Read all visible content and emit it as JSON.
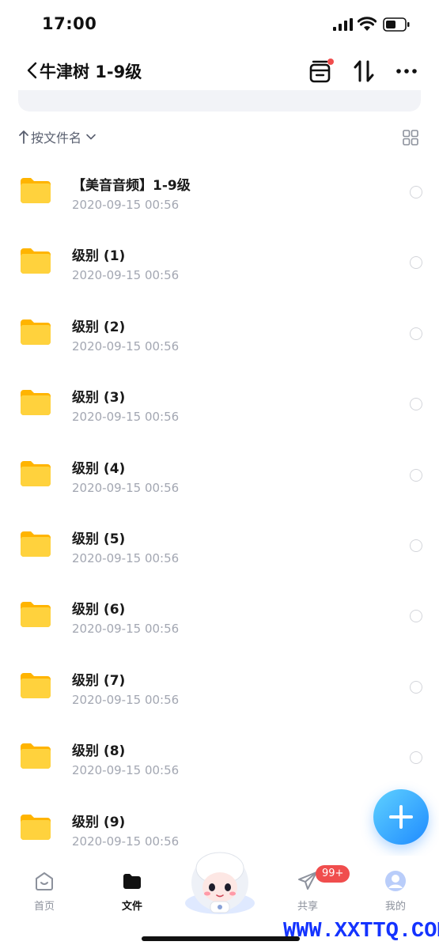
{
  "status_bar": {
    "time": "17:00"
  },
  "nav": {
    "title": "牛津树 1-9级"
  },
  "sort": {
    "label": "按文件名"
  },
  "files": [
    {
      "name": "【美音音频】1-9级",
      "date": "2020-09-15 00:56"
    },
    {
      "name": "级别 (1)",
      "date": "2020-09-15 00:56"
    },
    {
      "name": "级别 (2)",
      "date": "2020-09-15 00:56"
    },
    {
      "name": "级别 (3)",
      "date": "2020-09-15 00:56"
    },
    {
      "name": "级别 (4)",
      "date": "2020-09-15 00:56"
    },
    {
      "name": "级别 (5)",
      "date": "2020-09-15 00:56"
    },
    {
      "name": "级别 (6)",
      "date": "2020-09-15 00:56"
    },
    {
      "name": "级别 (7)",
      "date": "2020-09-15 00:56"
    },
    {
      "name": "级别 (8)",
      "date": "2020-09-15 00:56"
    },
    {
      "name": "级别 (9)",
      "date": "2020-09-15 00:56"
    }
  ],
  "tabs": [
    {
      "label": "首页",
      "icon": "home-icon"
    },
    {
      "label": "文件",
      "icon": "folder-icon"
    },
    {
      "label": "共享",
      "icon": "paper-plane-icon"
    },
    {
      "label": "我的",
      "icon": "avatar-icon"
    }
  ],
  "share_badge": "99+",
  "watermark": "WWW.XXTTQ.COM",
  "colors": {
    "folder": "#ffc61a",
    "fab_start": "#5fd1ff",
    "fab_end": "#1f8bff",
    "badge": "#f04d4d",
    "notify_dot": "#f04d4d",
    "watermark": "#1433ff"
  }
}
